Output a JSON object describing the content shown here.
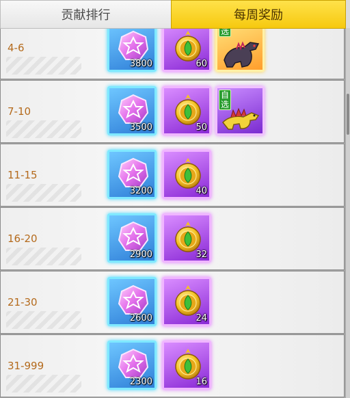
{
  "tabs": [
    {
      "label": "贡献排行",
      "active": false
    },
    {
      "label": "每周奖励",
      "active": true
    }
  ],
  "rows": [
    {
      "rank": "4-6",
      "gem_qty": "3800",
      "coin_qty": "60",
      "dino": {
        "tag": "选",
        "variant": "gold"
      }
    },
    {
      "rank": "7-10",
      "gem_qty": "3500",
      "coin_qty": "50",
      "dino": {
        "tag": "自选",
        "variant": "purple"
      }
    },
    {
      "rank": "11-15",
      "gem_qty": "3200",
      "coin_qty": "40"
    },
    {
      "rank": "16-20",
      "gem_qty": "2900",
      "coin_qty": "32"
    },
    {
      "rank": "21-30",
      "gem_qty": "2600",
      "coin_qty": "24"
    },
    {
      "rank": "31-999",
      "gem_qty": "2300",
      "coin_qty": "16"
    }
  ],
  "icons": {
    "gem": "pink-star-gem-icon",
    "coin": "gold-leaf-coin-icon",
    "dino": "dinosaur-pet-icon"
  },
  "colors": {
    "active_tab": "#f6c90f",
    "rank_text": "#b46a1c",
    "gem_frame": "#2f7fd8",
    "coin_frame": "#8a2ad6",
    "tag_green": "#2a9d2f"
  },
  "scroll": {
    "position": 0.2
  }
}
